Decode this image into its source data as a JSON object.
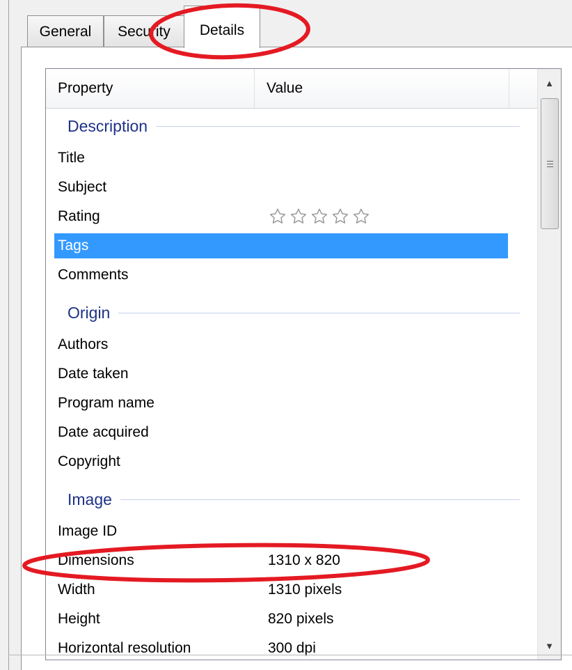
{
  "tabs": [
    {
      "label": "General",
      "active": false
    },
    {
      "label": "Security",
      "active": false
    },
    {
      "label": "Details",
      "active": true
    }
  ],
  "columns": {
    "property": "Property",
    "value": "Value"
  },
  "groups": {
    "description": "Description",
    "origin": "Origin",
    "image": "Image"
  },
  "rows": {
    "title": {
      "property": "Title",
      "value": ""
    },
    "subject": {
      "property": "Subject",
      "value": ""
    },
    "rating": {
      "property": "Rating",
      "stars": 0,
      "max_stars": 5
    },
    "tags": {
      "property": "Tags",
      "value": "",
      "selected": true
    },
    "comments": {
      "property": "Comments",
      "value": ""
    },
    "authors": {
      "property": "Authors",
      "value": ""
    },
    "date_taken": {
      "property": "Date taken",
      "value": ""
    },
    "program_name": {
      "property": "Program name",
      "value": ""
    },
    "date_acquired": {
      "property": "Date acquired",
      "value": ""
    },
    "copyright": {
      "property": "Copyright",
      "value": ""
    },
    "image_id": {
      "property": "Image ID",
      "value": ""
    },
    "dimensions": {
      "property": "Dimensions",
      "value": "1310 x 820"
    },
    "width": {
      "property": "Width",
      "value": "1310 pixels"
    },
    "height": {
      "property": "Height",
      "value": "820 pixels"
    },
    "horizontal_resolution": {
      "property": "Horizontal resolution",
      "value": "300 dpi"
    }
  },
  "colors": {
    "selection": "#3399ff",
    "group_header": "#1e3287",
    "annotation": "#e41a23"
  },
  "icons": {
    "star": "star-outline-icon",
    "scroll_up": "arrow-up-icon",
    "scroll_down": "arrow-down-icon"
  }
}
